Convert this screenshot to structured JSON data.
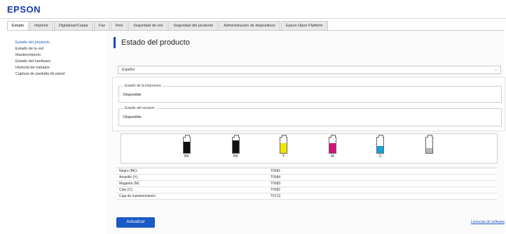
{
  "app": {
    "logo_text": "EPSON"
  },
  "tabs": [
    "Estado",
    "Imprimir",
    "Digitalizar/Copiar",
    "Fax",
    "Red",
    "Seguridad de red",
    "Seguridad del producto",
    "Administración de dispositivos",
    "Epson Open Platform"
  ],
  "sidebar": {
    "items": [
      "Estado del producto",
      "Estado de la red",
      "Mantenimiento",
      "Estado del hardware",
      "Historial de trabajos",
      "Captura de pantalla de panel"
    ]
  },
  "main": {
    "title": "Estado del producto",
    "language": {
      "selected": "Español"
    },
    "printer_status": {
      "legend": "Estado de la impresora",
      "value": "Disponible"
    },
    "scanner_status": {
      "legend": "Estado del escáner",
      "value": "Disponible"
    }
  },
  "inks": [
    {
      "label": "BK",
      "color": "#111111",
      "level": 0.72
    },
    {
      "label": "BK",
      "color": "#111111",
      "level": 0.82
    },
    {
      "label": "Y",
      "color": "#f1e400",
      "level": 0.65
    },
    {
      "label": "M",
      "color": "#d1127a",
      "level": 0.62
    },
    {
      "label": "C",
      "color": "#1aa3d6",
      "level": 0.45
    },
    {
      "label": "",
      "color": "#b5b5b5",
      "level": 0.3
    }
  ],
  "table": {
    "rows": [
      [
        "Negro (BK):",
        "T0581"
      ],
      [
        "Amarillo (Y):",
        "T0584"
      ],
      [
        "Magenta (M):",
        "T0583"
      ],
      [
        "Cian (C):",
        "T0582"
      ],
      [
        "Caja de mantenimiento:",
        "T6713"
      ]
    ]
  },
  "buttons": {
    "refresh": "Actualizar"
  },
  "links": {
    "license": "Licencias de software"
  }
}
